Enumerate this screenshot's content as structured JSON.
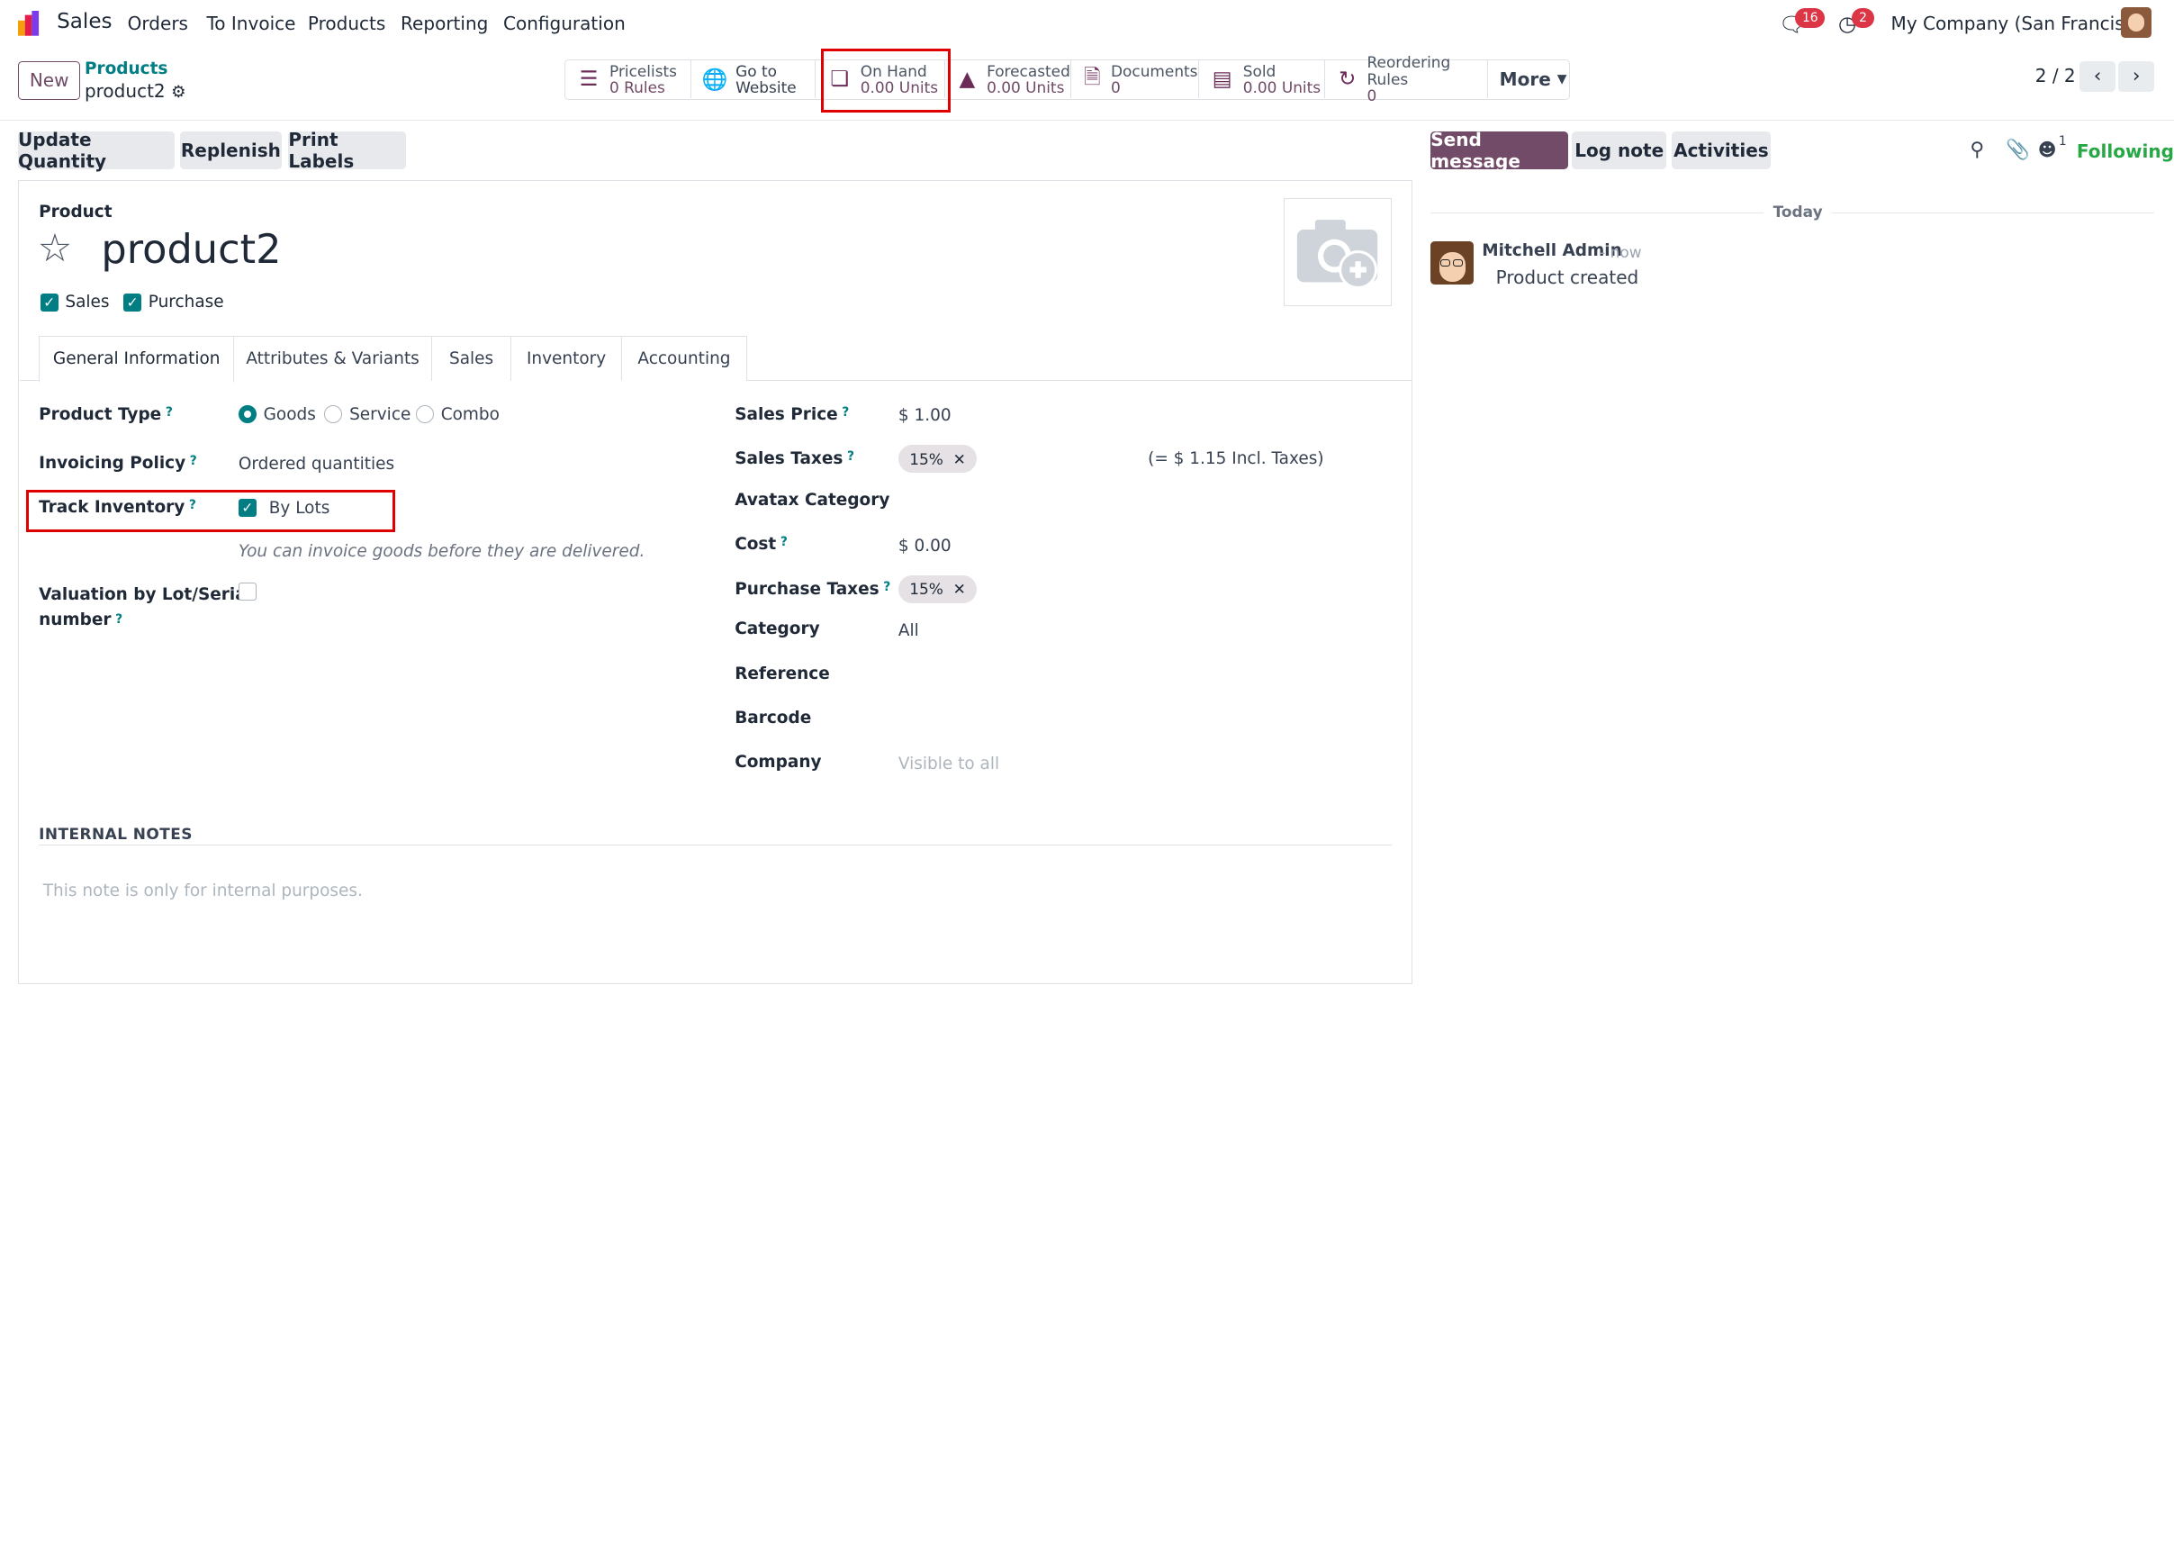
{
  "navbar": {
    "app_name": "Sales",
    "menu": [
      "Orders",
      "To Invoice",
      "Products",
      "Reporting",
      "Configuration"
    ],
    "messages_count": "16",
    "activities_count": "2",
    "company": "My Company (San Francisco)"
  },
  "control_panel": {
    "new_label": "New",
    "breadcrumb_parent": "Products",
    "breadcrumb_current": "product2",
    "pager": "2 / 2",
    "stats": [
      {
        "label": "Pricelists",
        "value": "0 Rules",
        "icon": "list-icon"
      },
      {
        "label": "Go to",
        "value": "Website",
        "icon": "globe-icon"
      },
      {
        "label": "On Hand",
        "value": "0.00 Units",
        "icon": "cubes-icon"
      },
      {
        "label": "Forecasted",
        "value": "0.00 Units",
        "icon": "area-chart-icon"
      },
      {
        "label": "Documents",
        "value": "0",
        "icon": "file-icon"
      },
      {
        "label": "Sold",
        "value": "0.00 Units",
        "icon": "signal-icon"
      },
      {
        "label": "Reordering Rules",
        "value": "0",
        "icon": "refresh-icon"
      }
    ],
    "more_label": "More"
  },
  "actions": {
    "update_quantity": "Update Quantity",
    "replenish": "Replenish",
    "print_labels": "Print Labels"
  },
  "form": {
    "product_label": "Product",
    "product_name": "product2",
    "sales_check": "Sales",
    "purchase_check": "Purchase",
    "tabs": [
      "General Information",
      "Attributes & Variants",
      "Sales",
      "Inventory",
      "Accounting"
    ],
    "left": {
      "product_type_label": "Product Type",
      "product_type_options": [
        "Goods",
        "Service",
        "Combo"
      ],
      "invoicing_policy_label": "Invoicing Policy",
      "invoicing_policy_value": "Ordered quantities",
      "track_inventory_label": "Track Inventory",
      "track_inventory_value": "By Lots",
      "invoice_hint": "You can invoice goods before they are delivered.",
      "valuation_label_1": "Valuation by Lot/Serial",
      "valuation_label_2": "number"
    },
    "right": {
      "sales_price_label": "Sales Price",
      "sales_price_value": "$ 1.00",
      "sales_taxes_label": "Sales Taxes",
      "sales_taxes_tag": "15%",
      "sales_taxes_incl": "(= $ 1.15 Incl. Taxes)",
      "avatax_label": "Avatax Category",
      "cost_label": "Cost",
      "cost_value": "$ 0.00",
      "purchase_taxes_label": "Purchase Taxes",
      "purchase_taxes_tag": "15%",
      "category_label": "Category",
      "category_value": "All",
      "reference_label": "Reference",
      "barcode_label": "Barcode",
      "company_label": "Company",
      "company_placeholder": "Visible to all"
    },
    "notes_header": "INTERNAL NOTES",
    "notes_placeholder": "This note is only for internal purposes."
  },
  "chatter": {
    "send_message": "Send message",
    "log_note": "Log note",
    "activities": "Activities",
    "followers_count": "1",
    "following": "Following",
    "date_separator": "Today",
    "author": "Mitchell Admin",
    "time": "- now",
    "message": "Product created"
  }
}
